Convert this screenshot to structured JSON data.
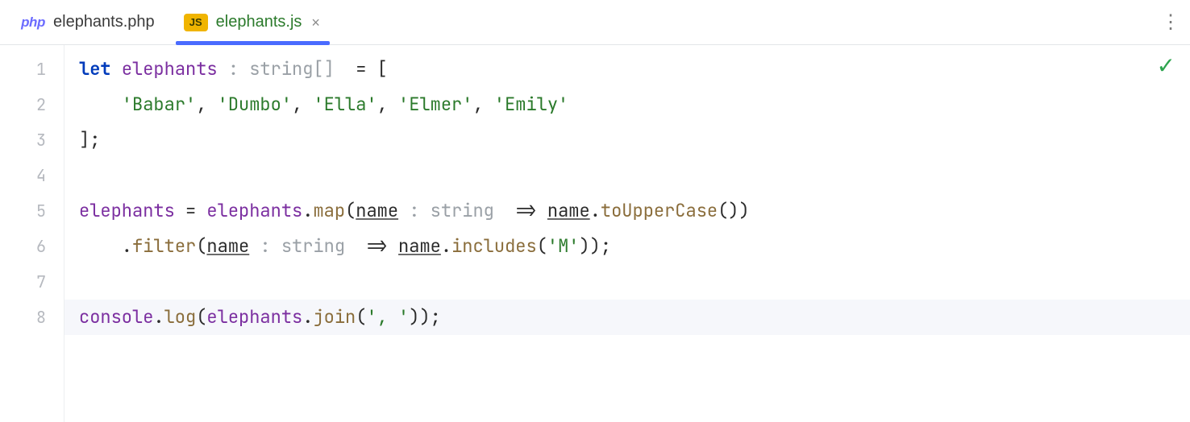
{
  "tabs": [
    {
      "icon": "php",
      "label": "elephants.php",
      "active": false,
      "closeable": false
    },
    {
      "icon": "js",
      "label": "elephants.js",
      "active": true,
      "closeable": true
    }
  ],
  "icon_text": {
    "php": "php",
    "js": "JS",
    "close": "×",
    "more": "⋮",
    "check": "✓"
  },
  "gutter": {
    "start": 1,
    "end": 8
  },
  "code": {
    "current_line": 8,
    "lines": [
      [
        {
          "cls": "kw",
          "t": "let "
        },
        {
          "cls": "ident",
          "t": "elephants"
        },
        {
          "cls": "hint",
          "t": " : string[]  "
        },
        {
          "cls": "punc",
          "t": "= ["
        }
      ],
      [
        {
          "cls": "punc",
          "t": "    "
        },
        {
          "cls": "str",
          "t": "'Babar'"
        },
        {
          "cls": "punc",
          "t": ", "
        },
        {
          "cls": "str",
          "t": "'Dumbo'"
        },
        {
          "cls": "punc",
          "t": ", "
        },
        {
          "cls": "str",
          "t": "'Ella'"
        },
        {
          "cls": "punc",
          "t": ", "
        },
        {
          "cls": "str",
          "t": "'Elmer'"
        },
        {
          "cls": "punc",
          "t": ", "
        },
        {
          "cls": "str",
          "t": "'Emily'"
        }
      ],
      [
        {
          "cls": "punc",
          "t": "];"
        }
      ],
      [
        {
          "cls": "punc",
          "t": ""
        }
      ],
      [
        {
          "cls": "ident",
          "t": "elephants"
        },
        {
          "cls": "punc",
          "t": " = "
        },
        {
          "cls": "ident",
          "t": "elephants"
        },
        {
          "cls": "punc",
          "t": "."
        },
        {
          "cls": "call",
          "t": "map"
        },
        {
          "cls": "punc",
          "t": "("
        },
        {
          "cls": "param",
          "t": "name"
        },
        {
          "cls": "hint",
          "t": " : string  "
        },
        {
          "cls": "punc",
          "t": "=> "
        },
        {
          "cls": "param",
          "t": "name"
        },
        {
          "cls": "punc",
          "t": "."
        },
        {
          "cls": "call",
          "t": "toUpperCase"
        },
        {
          "cls": "punc",
          "t": "())"
        }
      ],
      [
        {
          "cls": "punc",
          "t": "    ."
        },
        {
          "cls": "call",
          "t": "filter"
        },
        {
          "cls": "punc",
          "t": "("
        },
        {
          "cls": "param",
          "t": "name"
        },
        {
          "cls": "hint",
          "t": " : string  "
        },
        {
          "cls": "punc",
          "t": "=> "
        },
        {
          "cls": "param",
          "t": "name"
        },
        {
          "cls": "punc",
          "t": "."
        },
        {
          "cls": "call",
          "t": "includes"
        },
        {
          "cls": "punc",
          "t": "("
        },
        {
          "cls": "str",
          "t": "'M'"
        },
        {
          "cls": "punc",
          "t": "));"
        }
      ],
      [
        {
          "cls": "punc",
          "t": ""
        }
      ],
      [
        {
          "cls": "ident",
          "t": "console"
        },
        {
          "cls": "punc",
          "t": "."
        },
        {
          "cls": "call",
          "t": "log"
        },
        {
          "cls": "punc",
          "t": "("
        },
        {
          "cls": "ident",
          "t": "elephants"
        },
        {
          "cls": "punc",
          "t": "."
        },
        {
          "cls": "call",
          "t": "join"
        },
        {
          "cls": "punc",
          "t": "("
        },
        {
          "cls": "str",
          "t": "', '"
        },
        {
          "cls": "punc",
          "t": "));"
        }
      ]
    ]
  },
  "colors": {
    "accent_tab": "#4a6bff",
    "js_icon_bg": "#f0b400",
    "check": "#2da44e"
  }
}
